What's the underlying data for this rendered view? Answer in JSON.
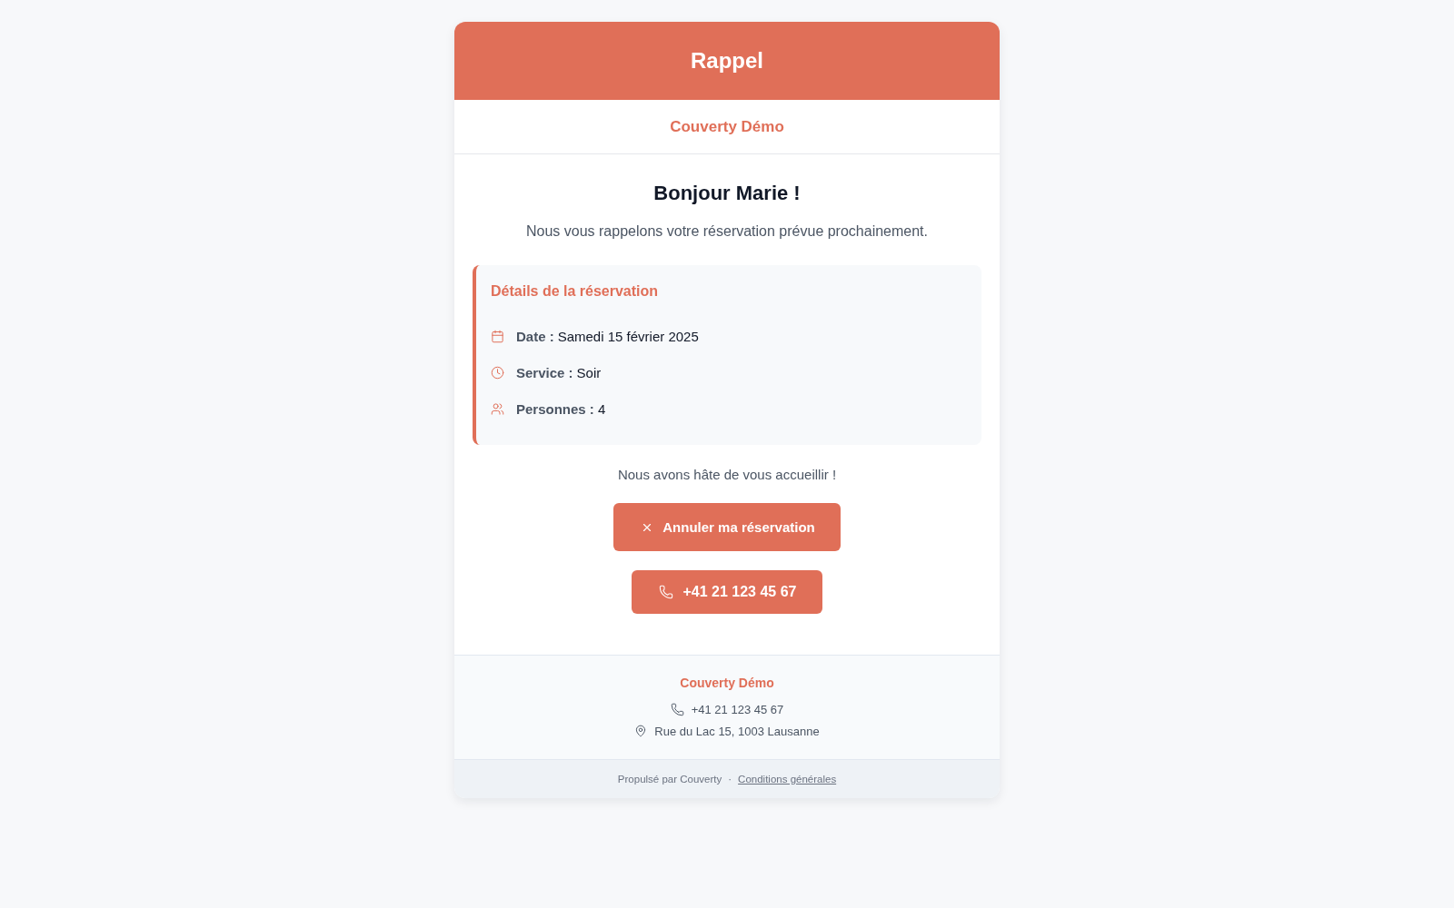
{
  "header": {
    "title": "Rappel"
  },
  "restaurant": {
    "name": "Couverty Démo"
  },
  "greeting": "Bonjour Marie !",
  "intro": "Nous vous rappelons votre réservation prévue prochainement.",
  "details": {
    "title": "Détails de la réservation",
    "items": [
      {
        "kind": "date",
        "label": "Date :",
        "value": "Samedi 15 février 2025"
      },
      {
        "kind": "time",
        "label": "Service :",
        "value": "Soir"
      },
      {
        "kind": "people",
        "label": "Personnes :",
        "value": "4"
      }
    ]
  },
  "closing": "Nous avons hâte de vous accueillir !",
  "actions": [
    {
      "kind": "cancel",
      "label": "Annuler ma réservation"
    },
    {
      "kind": "phone",
      "label": "+41 21 123 45 67"
    }
  ],
  "footer": {
    "name": "Couverty Démo",
    "contacts": [
      {
        "kind": "phone",
        "text": "+41 21 123 45 67"
      },
      {
        "kind": "address",
        "text": "Rue du Lac 15, 1003 Lausanne"
      }
    ]
  },
  "legal": {
    "powered_by": "Propulsé par Couverty",
    "separator": "·",
    "link": "Conditions générales"
  }
}
